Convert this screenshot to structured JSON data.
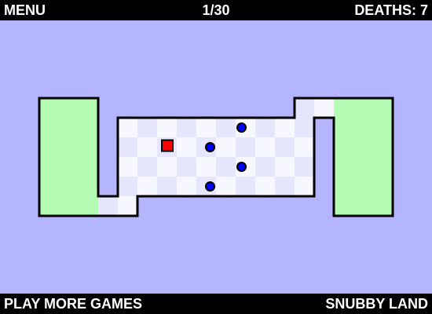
{
  "hud": {
    "menu_label": "MENU",
    "level_text": "1/30",
    "deaths_text": "DEATHS: 7"
  },
  "footer": {
    "more_games_label": "PLAY MORE GAMES",
    "brand_label": "SNUBBY LAND"
  },
  "colors": {
    "background": "#b4b5fe",
    "safe_zone": "#b4fcb4",
    "tile_light": "#f7f7ff",
    "tile_dark": "#e6e6ff",
    "wall": "#000000",
    "player": "#ff0000",
    "enemy": "#0000ff"
  },
  "level": {
    "player": {
      "col": 2,
      "row": 1
    },
    "enemies": [
      {
        "col": 5.8,
        "row": 0.0
      },
      {
        "col": 4.2,
        "row": 1.0
      },
      {
        "col": 5.8,
        "row": 2.0
      },
      {
        "col": 4.2,
        "row": 3.0
      }
    ]
  }
}
